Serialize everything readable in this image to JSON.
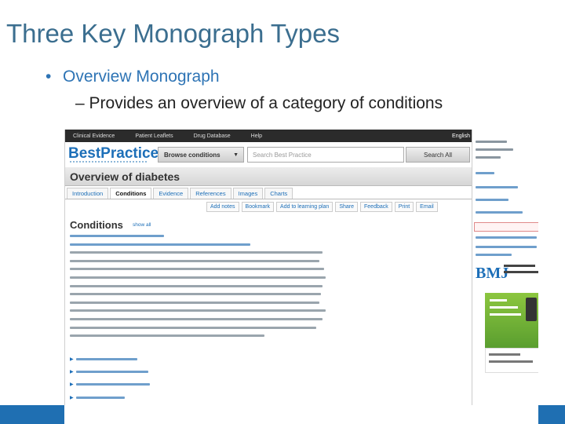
{
  "slide": {
    "title": "Three Key Monograph Types",
    "bullet": "Overview Monograph",
    "sub_bullet": "– Provides an overview of a category of conditions",
    "bullet_marker": "•"
  },
  "screenshot": {
    "top_nav": [
      "Clinical Evidence",
      "Patient Leaflets",
      "Drug Database",
      "Help"
    ],
    "language": "English",
    "logo": "BestPractice",
    "browse_button": "Browse conditions",
    "search_placeholder": "Search Best Practice",
    "search_button": "Search All",
    "page_title": "Overview of diabetes",
    "tabs": [
      "Introduction",
      "Conditions",
      "Evidence",
      "References",
      "Images",
      "Charts"
    ],
    "active_tab": "Conditions",
    "actions": [
      "Add notes",
      "Bookmark",
      "Add to learning plan",
      "Share",
      "Feedback",
      "Print",
      "Email"
    ],
    "section_heading": "Conditions",
    "show_all": "show all",
    "publisher": "BMJ"
  },
  "colors": {
    "title": "#3b6e8f",
    "bullet": "#2e74b5",
    "link": "#1d6fb8",
    "promo": "#8cc63f"
  }
}
